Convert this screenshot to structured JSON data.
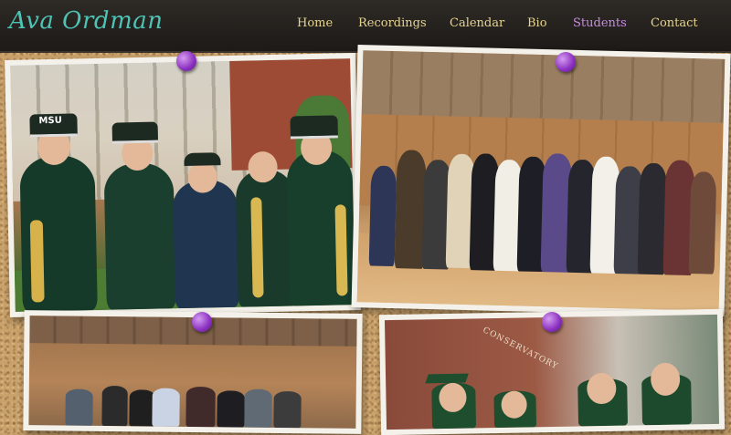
{
  "header": {
    "brand": "Ava Ordman",
    "nav": [
      {
        "label": "Home",
        "active": false
      },
      {
        "label": "Recordings",
        "active": false
      },
      {
        "label": "Calendar",
        "active": false
      },
      {
        "label": "Bio",
        "active": false
      },
      {
        "label": "Students",
        "active": true
      },
      {
        "label": "Contact",
        "active": false
      }
    ]
  },
  "colors": {
    "brand": "#4fc3b6",
    "nav_link": "#e6d48f",
    "nav_active": "#c68de0",
    "pin": "#8a2fc0"
  },
  "photos": {
    "band_cap_text": "MSU",
    "wall_sign_text": "CONSERVATORY"
  }
}
